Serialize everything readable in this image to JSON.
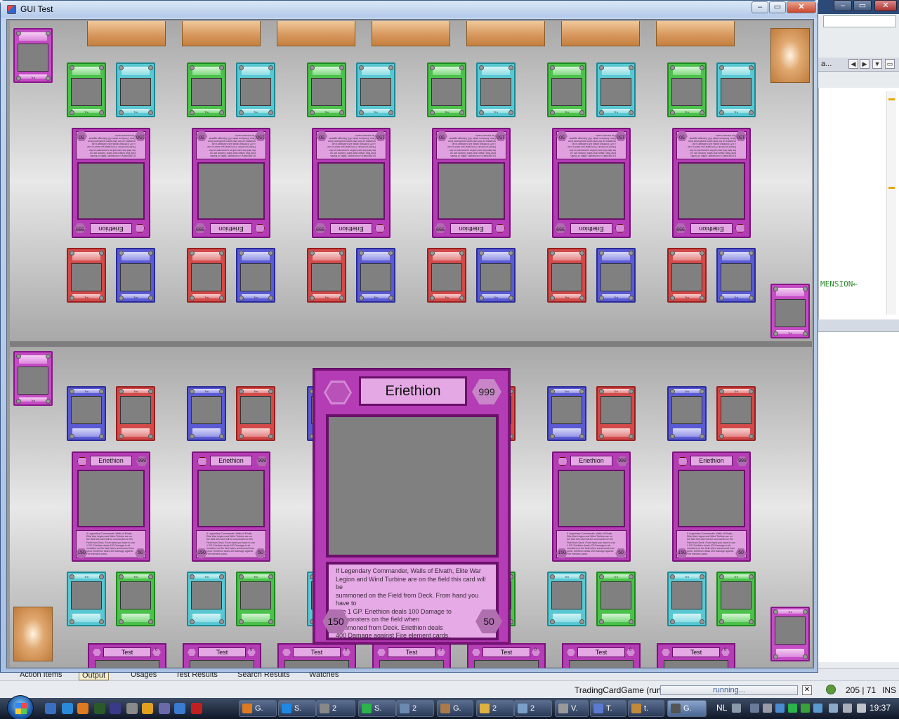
{
  "window": {
    "title": "GUI Test",
    "min_label": "–",
    "max_label": "▭",
    "close_label": "✕"
  },
  "zoom_card": {
    "name": "Eriethion",
    "level": "999",
    "text": "If Legendary Commander, Walls of Elvath, Elite War\nLegion and Wind Turbine are on the field this card will be\nsummoned on the Field from Deck. From hand you have to\nuse 1 GP. Eriethion deals 100 Damage to\nall monsters on the field when\nsummoned from Deck. Eriethion deals\n400 Damage against Fire element cards.",
    "attack": "150",
    "defense": "50"
  },
  "board_card": {
    "name": "Eriethion",
    "level": "999",
    "text": "If Legendary Commander, Walls of Elvath, Elite War Legion and Wind Turbine are on the field this card will be summoned on the Field from Deck. From hand you have to use 1 GP. Eriethion deals 100 Damage to all monsters on the field when summoned from Deck. Eriethion deals 400 Damage against Fire element cards.",
    "attack": "150",
    "defense": "50"
  },
  "hand_card": {
    "name": "Test",
    "value": "0"
  },
  "small_card_label": "Trn",
  "colors": {
    "green": "#4cc24c",
    "cyan": "#5ac8d2",
    "red": "#d24a4a",
    "blue": "#5a5ad2",
    "pink": "#c44cc4",
    "field": "#cfcfcf"
  },
  "ide": {
    "tab_label": "a...",
    "code_text": "MENSION←",
    "bottom_tabs": [
      "Action Items",
      "Output",
      "Usages",
      "Test Results",
      "Search Results",
      "Watches"
    ],
    "selected_tab": "Output",
    "status_app": "TradingCardGame (run)",
    "status_progress": "running...",
    "status_position": "205 | 71",
    "status_mode": "INS"
  },
  "taskbar": {
    "buttons": [
      "G.",
      "S.",
      "2",
      "S.",
      "2",
      "G.",
      "2",
      "2",
      "V.",
      "T.",
      "t.",
      "G."
    ],
    "language": "NL",
    "time": "19:37"
  }
}
